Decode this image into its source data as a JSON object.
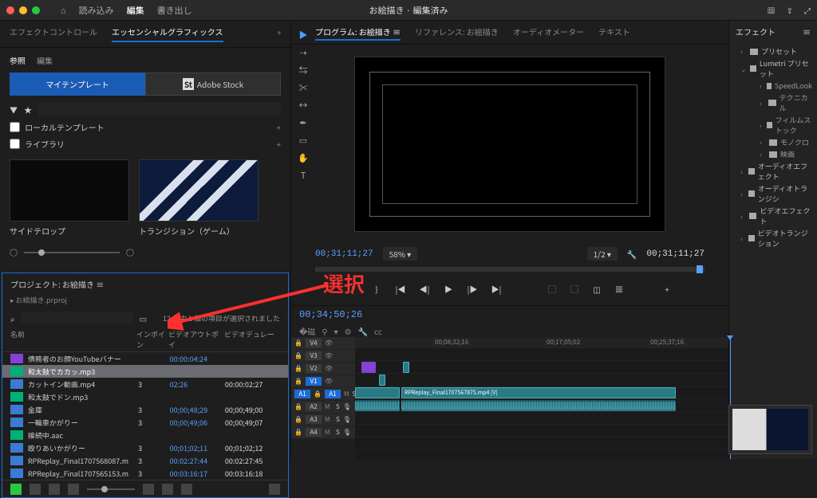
{
  "topbar": {
    "home_icon": "home-icon",
    "import": "読み込み",
    "edit": "編集",
    "export": "書き出し",
    "title": "お絵描き · 編集済み"
  },
  "left_panel": {
    "tab_effect_controls": "エフェクトコントロール",
    "tab_essential_graphics": "エッセンシャルグラフィックス",
    "sub_browse": "参照",
    "sub_edit": "編集",
    "btn_my_templates": "マイテンプレート",
    "btn_adobe_stock": "Adobe Stock",
    "filter_local": "ローカルテンプレート",
    "filter_library": "ライブラリ",
    "thumb1_caption": "サイドテロップ",
    "thumb2_caption": "トランジション（ゲーム）"
  },
  "project": {
    "title": "プロジェクト: お絵描き ≡",
    "file": "お絵描き.prproj",
    "sel_info": "12 個中 1 個の項目が選択されました",
    "col_name": "名前",
    "col_in": "インポイン",
    "col_out": "ビデオアウトポイ",
    "col_dur": "ビデオデュレー",
    "rows": [
      {
        "icon": "ps",
        "name": "債務者のお顔YouTubeバナー",
        "c2": "",
        "c3": "00:00:04:24",
        "c4": ""
      },
      {
        "icon": "au",
        "name": "和太鼓でカカッ.mp3",
        "c2": "",
        "c3": "",
        "c4": "",
        "sel": true
      },
      {
        "icon": "vd",
        "name": "カットイン動画.mp4",
        "c2": "3",
        "c3": "02:26",
        "c4": "00:00:02:27"
      },
      {
        "icon": "au",
        "name": "和太鼓でドン.mp3",
        "c2": "",
        "c3": "",
        "c4": ""
      },
      {
        "icon": "vd",
        "name": "金庫",
        "c2": "3",
        "c3": "00;00;48;29",
        "c4": "00;00;49;00"
      },
      {
        "icon": "vd",
        "name": "一輪車かがりー",
        "c2": "3",
        "c3": "00;00;49;06",
        "c4": "00;00;49;07"
      },
      {
        "icon": "au",
        "name": "接続中.aac",
        "c2": "",
        "c3": "",
        "c4": ""
      },
      {
        "icon": "vd",
        "name": "殴りあいかがりー",
        "c2": "3",
        "c3": "00;01;02;11",
        "c4": "00;01;02;12"
      },
      {
        "icon": "vd",
        "name": "RPReplay_Final1707568087.m",
        "c2": "3",
        "c3": "00:02:27:44",
        "c4": "00:02:27:45"
      },
      {
        "icon": "vd",
        "name": "RPReplay_Final1707565153.m",
        "c2": "3",
        "c3": "00:03:16:17",
        "c4": "00:03:16:18"
      }
    ]
  },
  "program": {
    "tab_program": "プログラム: お絵描き ≡",
    "tab_reference": "リファレンス: お絵描き",
    "tab_audio": "オーディオメーター",
    "tab_text": "テキスト",
    "tc_left": "00;31;11;27",
    "zoom": "58%",
    "quality": "1/2",
    "tc_right": "00;31;11;27"
  },
  "timeline": {
    "tc": "00;34;50;26",
    "ruler": [
      "00;08;32;16",
      "00;17;05;02",
      "00;25;37;16"
    ],
    "tracks_v": [
      "V4",
      "V3",
      "V2",
      "V1"
    ],
    "tracks_a": [
      "A1",
      "A2",
      "A3",
      "A4"
    ],
    "clip_label": "RPReplay_Final1707567875.mp4 [V]"
  },
  "effects": {
    "title": "エフェクト",
    "presets": "プリセット",
    "lumetri": "Lumetri プリセット",
    "lumetri_children": [
      "SpeedLook",
      "テクニカル",
      "フィルムストック",
      "モノクロ",
      "映画"
    ],
    "audio_fx": "オーディオエフェクト",
    "audio_tr": "オーディオトランジシ",
    "video_fx": "ビデオエフェクト",
    "video_tr": "ビデオトランジション"
  },
  "annotation": "選択"
}
